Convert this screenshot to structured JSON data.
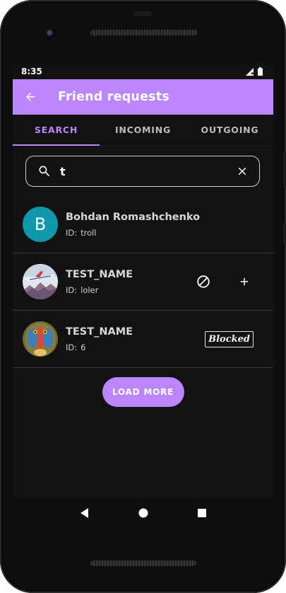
{
  "status_bar": {
    "time": "8:35"
  },
  "app_bar": {
    "title": "Friend requests"
  },
  "tabs": [
    {
      "label": "SEARCH",
      "active": true
    },
    {
      "label": "INCOMING",
      "active": false
    },
    {
      "label": "OUTGOING",
      "active": false
    }
  ],
  "search": {
    "value": "t"
  },
  "users": [
    {
      "avatar_letter": "B",
      "name": "Bohdan Romashchenko",
      "id_label": "ID:",
      "id_value": "troll"
    },
    {
      "name": "TEST_NAME",
      "id_label": "ID:",
      "id_value": "loler"
    },
    {
      "name": "TEST_NAME",
      "id_label": "ID:",
      "id_value": "6",
      "badge": "Blocked"
    }
  ],
  "load_more": {
    "label": "LOAD MORE"
  },
  "colors": {
    "accent": "#bb86fc",
    "background": "#121212",
    "avatar_teal": "#0f98ac",
    "divider": "#3a3a3a"
  },
  "icons": [
    "back-arrow-icon",
    "search-icon",
    "clear-icon",
    "block-icon",
    "add-icon",
    "nav-back-icon",
    "nav-home-icon",
    "nav-recents-icon",
    "signal-icon",
    "battery-icon"
  ]
}
